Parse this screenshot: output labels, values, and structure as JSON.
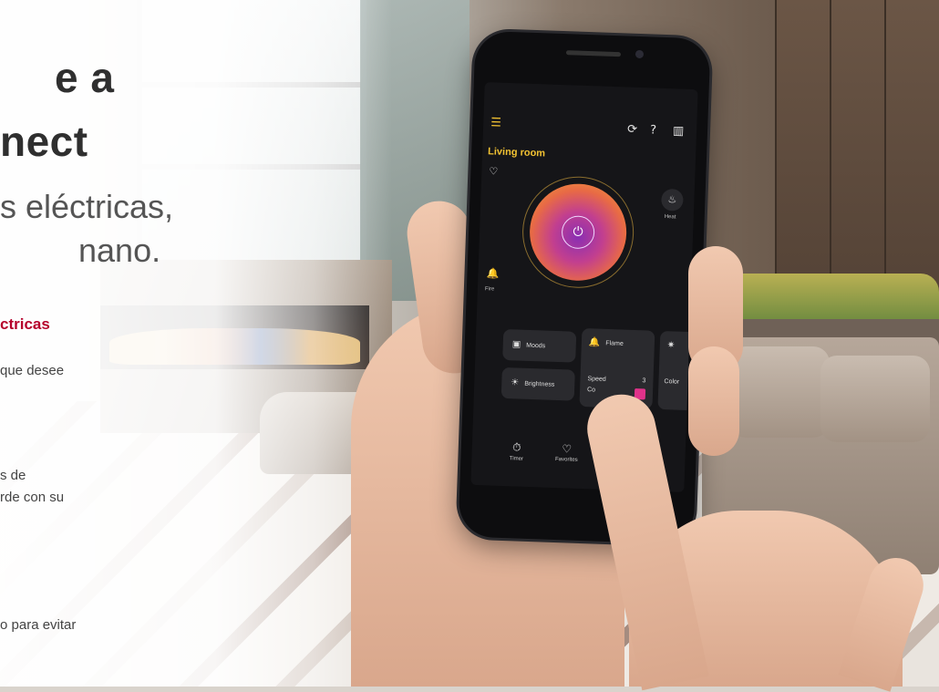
{
  "promo": {
    "title_line1": "e a",
    "title_line2": "nect",
    "subtitle_line1": "s eléctricas,",
    "subtitle_line2": "nano.",
    "section_heading": "ctricas",
    "body_line1": "que desee",
    "body_line2": "s de",
    "body_line3": "rde con su",
    "body_line4": "o para evitar"
  },
  "app": {
    "room_title": "Living room",
    "heat_label": "Heat",
    "fire_label": "Fire",
    "cards": {
      "moods": "Moods",
      "brightness": "Brightness",
      "flame": "Flame",
      "speed": "Speed",
      "color_short": "Co",
      "speed_value": "3",
      "color": "Color"
    },
    "bottom": {
      "timer": "Timer",
      "favorites": "Favorites"
    },
    "accent_color": "#f2c232",
    "swatch_color": "#e0328a"
  },
  "icons": {
    "menu": "menu-icon",
    "refresh": "refresh-icon",
    "help": "help-icon",
    "grid": "grid-icon",
    "heart_badge": "heart-icon",
    "power": "power-icon",
    "heat": "heat-icon",
    "fire": "fire-icon",
    "moods": "moods-icon",
    "brightness": "sun-icon",
    "flame": "flame-icon",
    "color": "bulb-icon",
    "timer": "timer-icon",
    "favorites": "heart-outline-icon"
  }
}
